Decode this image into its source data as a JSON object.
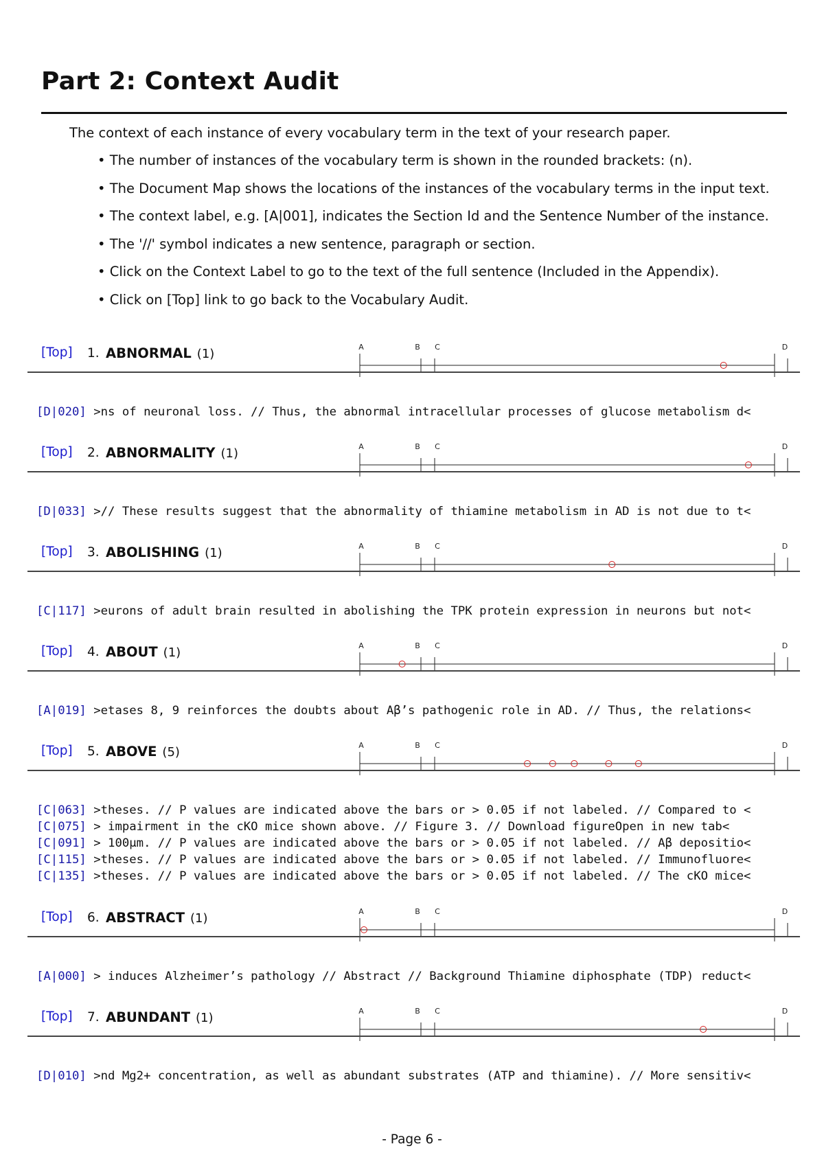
{
  "title": "Part 2: Context Audit",
  "intro": "The context of each instance of every vocabulary term in the text of your research paper.",
  "bullets": [
    "• The number of instances of the vocabulary term is shown in the rounded brackets: (n).",
    "• The Document Map shows the locations of the instances of the vocabulary terms in the input text.",
    "• The context label, e.g. [A|001], indicates the Section Id and the Sentence Number of the instance.",
    "• The '//' symbol indicates a new sentence, paragraph or section.",
    "• Click on the Context Label to go to the text of the full sentence (Included in the Appendix).",
    "• Click on [Top] link to go back to the Vocabulary Audit."
  ],
  "map_sections": [
    "A",
    "B",
    "C",
    "D"
  ],
  "top_label": "[Top]",
  "entries": [
    {
      "num": "1.",
      "term": "ABNORMAL",
      "count": "(1)",
      "positions": [
        0.877
      ],
      "contexts": [
        {
          "label": "[D|020]",
          "text": " >ns of neuronal loss. // Thus, the abnormal intracellular processes of glucose metabolism d<"
        }
      ]
    },
    {
      "num": "2.",
      "term": "ABNORMALITY",
      "count": "(1)",
      "positions": [
        0.937
      ],
      "contexts": [
        {
          "label": "[D|033]",
          "text": " >// These results suggest that the abnormality of thiamine metabolism in AD is not due to t<"
        }
      ]
    },
    {
      "num": "3.",
      "term": "ABOLISHING",
      "count": "(1)",
      "positions": [
        0.608
      ],
      "contexts": [
        {
          "label": "[C|117]",
          "text": " >eurons of adult brain resulted in abolishing the TPK protein expression in neurons but not<"
        }
      ]
    },
    {
      "num": "4.",
      "term": "ABOUT",
      "count": "(1)",
      "positions": [
        0.102
      ],
      "contexts": [
        {
          "label": "[A|019]",
          "text": " >etases 8, 9 reinforces the doubts about Aβ’s pathogenic role in AD. // Thus, the relations<"
        }
      ]
    },
    {
      "num": "5.",
      "term": "ABOVE",
      "count": "(5)",
      "positions": [
        0.404,
        0.465,
        0.517,
        0.6,
        0.672
      ],
      "contexts": [
        {
          "label": "[C|063]",
          "text": " >theses. // P values are indicated above the bars or > 0.05 if not labeled. // Compared to <"
        },
        {
          "label": "[C|075]",
          "text": " > impairment in the cKO mice shown above. // Figure 3. // Download figureOpen in new tab<"
        },
        {
          "label": "[C|091]",
          "text": " > 100μm. // P values are indicated above the bars or > 0.05 if not labeled. // Aβ depositio<"
        },
        {
          "label": "[C|115]",
          "text": " >theses. // P values are indicated above the bars or > 0.05 if not labeled. // Immunofluore<"
        },
        {
          "label": "[C|135]",
          "text": " >theses. // P values are indicated above the bars or > 0.05 if not labeled. // The cKO mice<"
        }
      ]
    },
    {
      "num": "6.",
      "term": "ABSTRACT",
      "count": "(1)",
      "positions": [
        0.01
      ],
      "contexts": [
        {
          "label": "[A|000]",
          "text": " > induces Alzheimer’s pathology // Abstract // Background Thiamine diphosphate (TDP) reduct<"
        }
      ]
    },
    {
      "num": "7.",
      "term": "ABUNDANT",
      "count": "(1)",
      "positions": [
        0.828
      ],
      "contexts": [
        {
          "label": "[D|010]",
          "text": " >nd Mg2+ concentration, as well as abundant substrates (ATP and thiamine). // More sensitiv<"
        }
      ]
    }
  ],
  "footer": "-  Page 6  -"
}
